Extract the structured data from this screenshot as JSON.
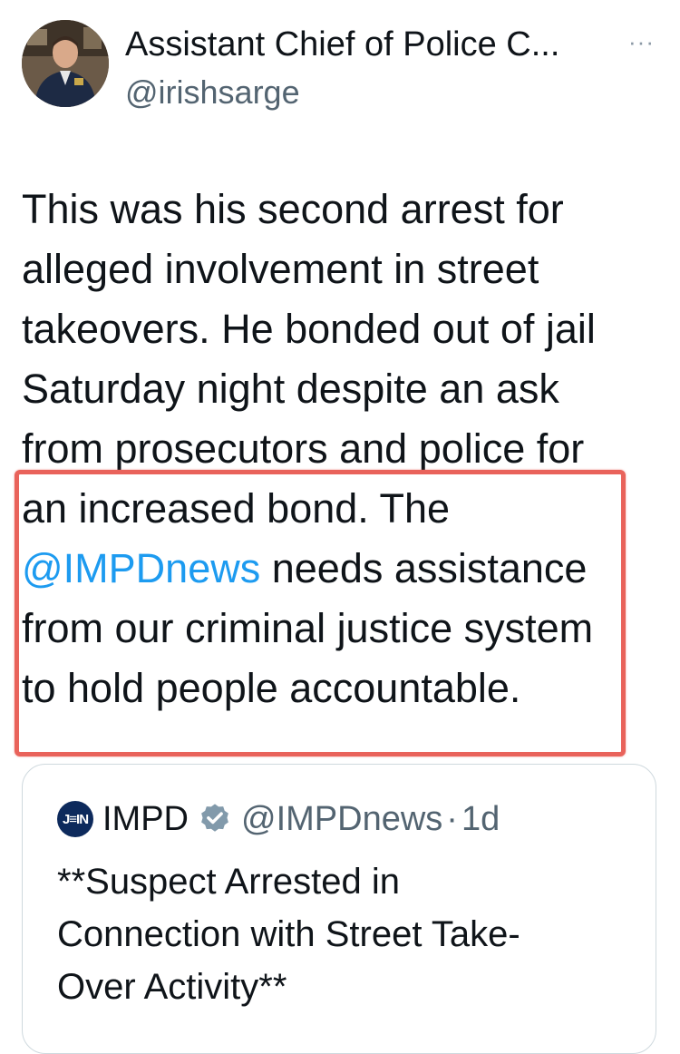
{
  "tweet": {
    "author_name": "Assistant Chief of Police C...",
    "author_handle": "@irishsarge",
    "more_label": "···",
    "text_lines": [
      "This was his second arrest for",
      "alleged involvement in street",
      "takeovers. He bonded out of jail",
      "Saturday night despite an ask",
      "from prosecutors and police for",
      "an increased bond. The"
    ],
    "mention": "@IMPDnews",
    "mention_line_rest": " needs assistance",
    "text_lines_after": [
      "from our criminal justice system",
      "to hold people accountable."
    ]
  },
  "quoted_tweet": {
    "avatar_text": "J≡IN",
    "author_name": "IMPD",
    "author_handle": "@IMPDnews",
    "separator": "·",
    "time": "1d",
    "text_lines": [
      "**Suspect Arrested in",
      "Connection with Street Take-",
      "Over Activity**"
    ]
  },
  "colors": {
    "link": "#1d9bf0",
    "secondary_text": "#536471",
    "highlight_border": "#e9635b",
    "verified_badge": "#829aab"
  },
  "icons": {
    "more": "more-horizontal-icon",
    "verified": "verified-badge-icon"
  }
}
